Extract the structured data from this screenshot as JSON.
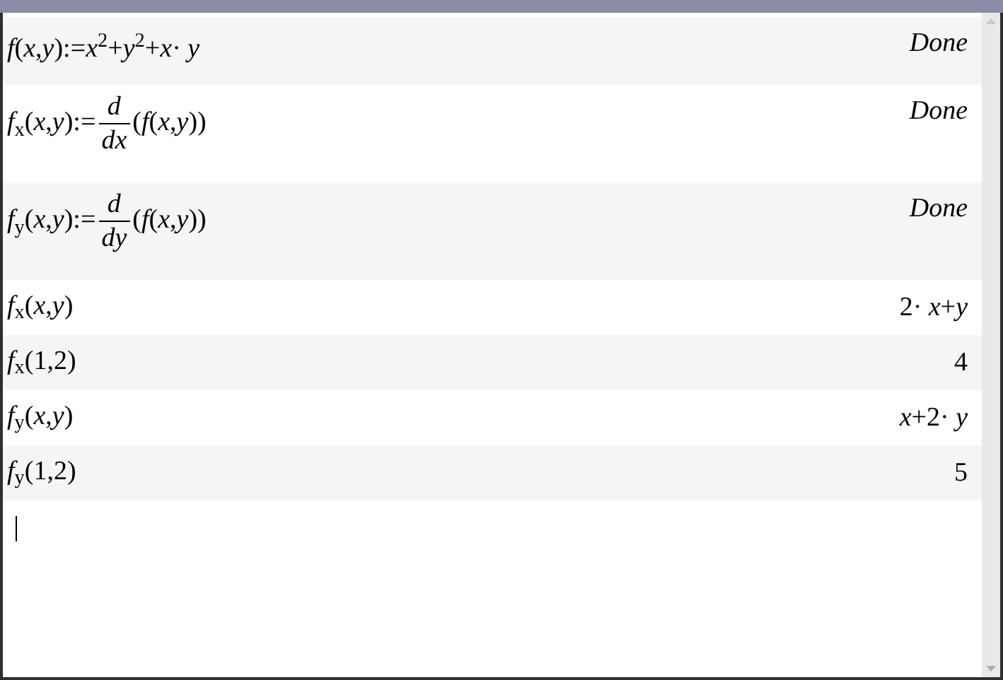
{
  "entries": [
    {
      "kind": "plain",
      "input": "*f*(*x*,*y*):=*x*$^{2}$+*y*$^{2}$+*x*· *y*",
      "result": "Done",
      "result_italic": true
    },
    {
      "kind": "derivative",
      "input": "*f*$_{x}$(*x*,*y*):=",
      "numerator": "*d*",
      "denominator": "*dx*",
      "argument": "(*f*(*x*,*y*))",
      "result": "Done",
      "result_italic": true
    },
    {
      "kind": "derivative",
      "input": "*f*$_{y}$(*x*,*y*):=",
      "numerator": "*d*",
      "denominator": "*dy*",
      "argument": "(*f*(*x*,*y*))",
      "result": "Done",
      "result_italic": true
    },
    {
      "kind": "plain",
      "input": "*f*$_{x}$(*x*,*y*)",
      "result": "2· *x*+*y*",
      "result_italic": false
    },
    {
      "kind": "plain",
      "input": "*f*$_{x}$(1,2)",
      "result": "4",
      "result_italic": false
    },
    {
      "kind": "plain",
      "input": "*f*$_{y}$(*x*,*y*)",
      "result": "*x*+2· *y*",
      "result_italic": false
    },
    {
      "kind": "plain",
      "input": "*f*$_{y}$(1,2)",
      "result": "5",
      "result_italic": false
    }
  ]
}
